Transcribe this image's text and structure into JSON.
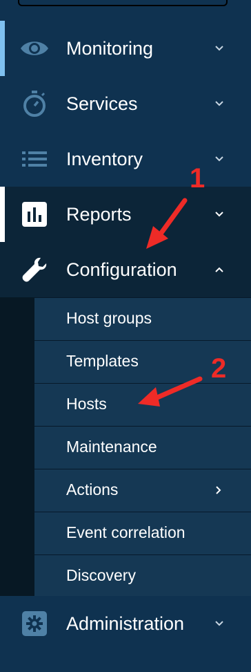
{
  "menu": {
    "items": [
      {
        "label": "Monitoring",
        "icon": "eye-icon",
        "expanded": false
      },
      {
        "label": "Services",
        "icon": "stopwatch-icon",
        "expanded": false
      },
      {
        "label": "Inventory",
        "icon": "list-icon",
        "expanded": false
      },
      {
        "label": "Reports",
        "icon": "bar-chart-icon",
        "expanded": false
      },
      {
        "label": "Configuration",
        "icon": "wrench-icon",
        "expanded": true
      },
      {
        "label": "Administration",
        "icon": "gear-icon",
        "expanded": false
      }
    ],
    "configuration_submenu": [
      {
        "label": "Host groups",
        "has_submenu": false
      },
      {
        "label": "Templates",
        "has_submenu": false
      },
      {
        "label": "Hosts",
        "has_submenu": false
      },
      {
        "label": "Maintenance",
        "has_submenu": false
      },
      {
        "label": "Actions",
        "has_submenu": true
      },
      {
        "label": "Event correlation",
        "has_submenu": false
      },
      {
        "label": "Discovery",
        "has_submenu": false
      }
    ]
  },
  "annotations": {
    "step1": "1",
    "step2": "2"
  },
  "colors": {
    "background": "#0f3250",
    "configuration_bg": "#0c2538",
    "submenu_bg": "#153854",
    "submenu_gutter": "#071824",
    "monitoring_accent": "#7fc1f0",
    "reports_accent": "#ffffff",
    "annotation": "#ee2b27",
    "icon": "#4f81a6"
  }
}
